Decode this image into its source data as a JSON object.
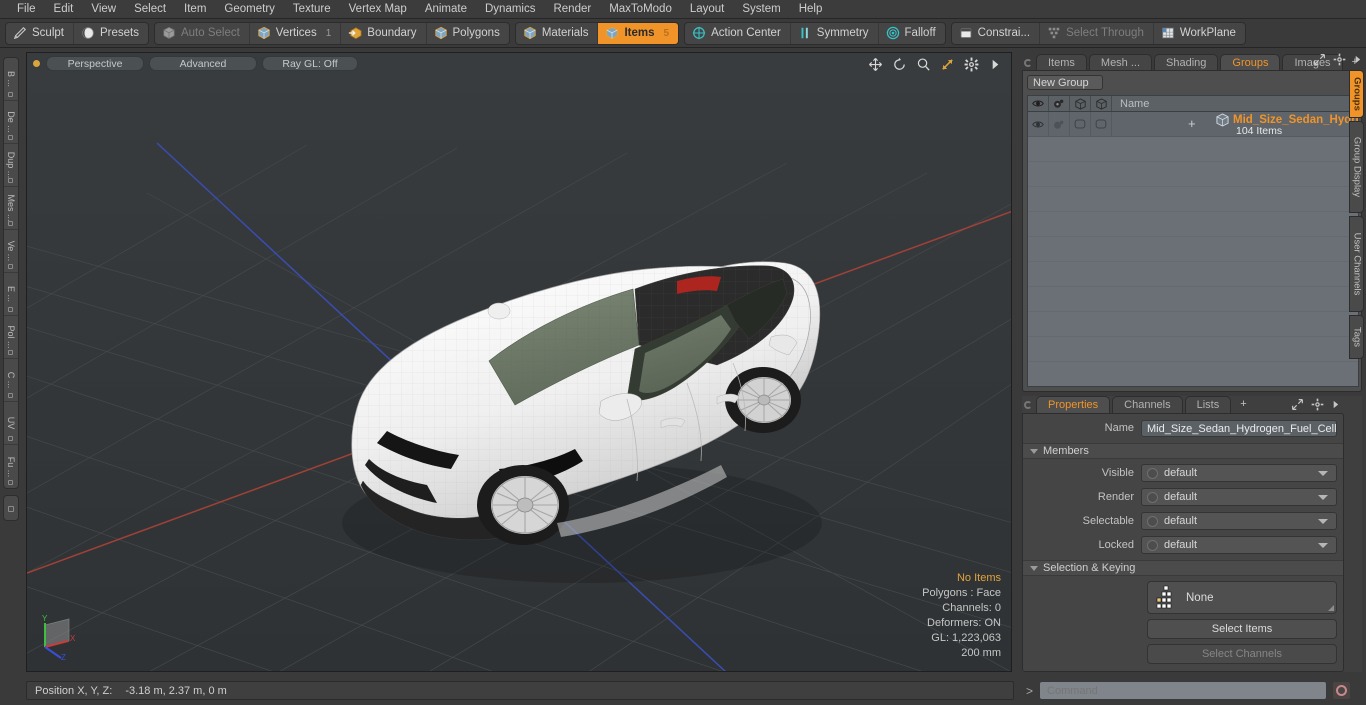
{
  "menubar": {
    "items": [
      "File",
      "Edit",
      "View",
      "Select",
      "Item",
      "Geometry",
      "Texture",
      "Vertex Map",
      "Animate",
      "Dynamics",
      "Render",
      "MaxToModo",
      "Layout",
      "System",
      "Help"
    ]
  },
  "toolbar": {
    "group1": [
      {
        "label": "Sculpt",
        "icon": "pencil-icon",
        "state": "normal",
        "badge": ""
      },
      {
        "label": "Presets",
        "icon": "sphere-icon",
        "state": "normal",
        "badge": ""
      }
    ],
    "group2": [
      {
        "label": "Auto Select",
        "icon": "cube-icon",
        "state": "disabled",
        "badge": ""
      },
      {
        "label": "Vertices",
        "icon": "cube-blue-icon",
        "state": "normal",
        "badge": "1"
      },
      {
        "label": "Boundary",
        "icon": "arrow-cube-icon",
        "state": "normal",
        "badge": ""
      },
      {
        "label": "Polygons",
        "icon": "cube-blue-icon",
        "state": "normal",
        "badge": ""
      }
    ],
    "group3": [
      {
        "label": "Materials",
        "icon": "cube-blue-icon",
        "state": "normal",
        "badge": ""
      },
      {
        "label": "Items",
        "icon": "cube-blue-icon",
        "state": "active",
        "badge": "5"
      }
    ],
    "group4": [
      {
        "label": "Action Center",
        "icon": "crosshair-icon",
        "state": "normal",
        "badge": ""
      },
      {
        "label": "Symmetry",
        "icon": "bars-icon",
        "state": "normal",
        "badge": ""
      },
      {
        "label": "Falloff",
        "icon": "target-icon",
        "state": "normal",
        "badge": ""
      }
    ],
    "group5": [
      {
        "label": "Constrai...",
        "icon": "square-icon",
        "state": "normal",
        "badge": ""
      },
      {
        "label": "Select Through",
        "icon": "dots-icon",
        "state": "disabled",
        "badge": ""
      },
      {
        "label": "WorkPlane",
        "icon": "grid-icon",
        "state": "normal",
        "badge": ""
      }
    ]
  },
  "left_rail": {
    "tabs": [
      "B ...",
      "De ...",
      "Dup ...",
      "Mes ...",
      "Ve ...",
      "E ...",
      "Pol ...",
      "C ...",
      "UV",
      "Fu ..."
    ]
  },
  "viewport": {
    "pills": [
      "Perspective",
      "Advanced",
      "Ray GL: Off"
    ],
    "tools": [
      "move-icon",
      "rotate-icon",
      "zoom-icon",
      "fit-icon",
      "gear-icon",
      "arrow-right-icon"
    ],
    "stats": {
      "selection": "No Items",
      "polygons": "Polygons : Face",
      "channels": "Channels: 0",
      "deformers": "Deformers: ON",
      "gl": "GL: 1,223,063",
      "scale": "200 mm"
    },
    "gizmo": {
      "x": "X",
      "y": "Y",
      "z": "Z"
    },
    "colors": {
      "background": "#323638",
      "axis_x": "#c0493f",
      "axis_z": "#3f56c0",
      "grid": "#454a4d",
      "body": "#f2f2f2",
      "glass": "#6e7a66",
      "roof": "#2a2a2a",
      "accent": "#f0942a"
    }
  },
  "right_panel": {
    "tabs": [
      {
        "label": "Items",
        "active": false
      },
      {
        "label": "Mesh ...",
        "active": false
      },
      {
        "label": "Shading",
        "active": false
      },
      {
        "label": "Groups",
        "active": true
      },
      {
        "label": "Images",
        "active": false
      },
      {
        "label": "+",
        "active": false
      }
    ],
    "new_group_label": "New Group",
    "list": {
      "columns": [
        "eye-icon",
        "render-icon",
        "cube-outline-icon",
        "cube-outline-icon"
      ],
      "name_header": "Name",
      "rows": [
        {
          "name": "Mid_Size_Sedan_Hydrogen_Fue ...",
          "sub": "104 Items",
          "expander": "+"
        }
      ]
    }
  },
  "properties": {
    "tabs": [
      {
        "label": "Properties",
        "active": true
      },
      {
        "label": "Channels",
        "active": false
      },
      {
        "label": "Lists",
        "active": false
      },
      {
        "label": "+",
        "active": false
      }
    ],
    "name_label": "Name",
    "name_value": "Mid_Size_Sedan_Hydrogen_Fuel_Cell_",
    "members_section": "Members",
    "members": [
      {
        "label": "Visible",
        "value": "default"
      },
      {
        "label": "Render",
        "value": "default"
      },
      {
        "label": "Selectable",
        "value": "default"
      },
      {
        "label": "Locked",
        "value": "default"
      }
    ],
    "selection_section": "Selection & Keying",
    "selection_set": "None",
    "select_items_label": "Select Items",
    "select_channels_label": "Select Channels",
    "more_label": ">>"
  },
  "vertical_tabs": [
    {
      "label": "Groups",
      "active": true
    },
    {
      "label": "Group Display",
      "active": false
    },
    {
      "label": "User Channels",
      "active": false
    },
    {
      "label": "Tags",
      "active": false
    }
  ],
  "statusbar": {
    "position_label": "Position X, Y, Z:",
    "position_value": "-3.18 m, 2.37 m, 0 m",
    "caret": ">",
    "command_placeholder": "Command",
    "record_icon": "record-circle-icon"
  }
}
